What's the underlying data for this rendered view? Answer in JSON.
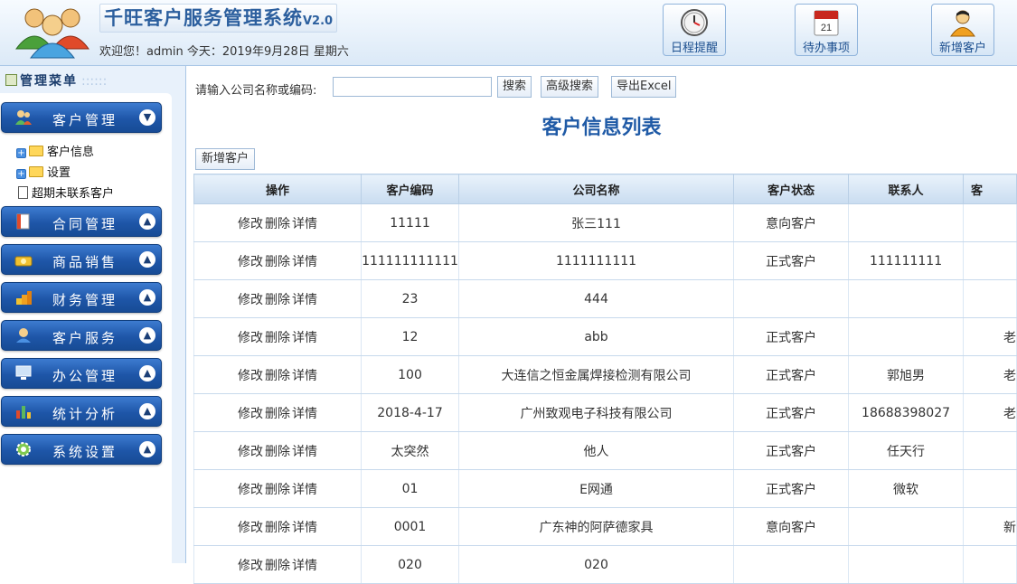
{
  "header": {
    "title": "千旺客户服务管理系统",
    "version": "V2.0",
    "welcome": "欢迎您！admin 今天：2019年9月28日  星期六",
    "buttons": [
      {
        "label": "日程提醒",
        "icon": "clock-icon"
      },
      {
        "label": "待办事项",
        "icon": "calendar-icon"
      },
      {
        "label": "新增客户",
        "icon": "user-add-icon"
      }
    ],
    "calendar_day": "21"
  },
  "sidebar": {
    "title": "管理菜单",
    "menus": [
      {
        "label": "客户管理",
        "icon": "users-icon",
        "toggle": "▼"
      },
      {
        "label": "合同管理",
        "icon": "contract-icon",
        "toggle": "▲"
      },
      {
        "label": "商品销售",
        "icon": "money-icon",
        "toggle": "▲"
      },
      {
        "label": "财务管理",
        "icon": "coins-icon",
        "toggle": "▲"
      },
      {
        "label": "客户服务",
        "icon": "service-icon",
        "toggle": "▲"
      },
      {
        "label": "办公管理",
        "icon": "computer-icon",
        "toggle": "▲"
      },
      {
        "label": "统计分析",
        "icon": "chart-icon",
        "toggle": "▲"
      },
      {
        "label": "系统设置",
        "icon": "gear-icon",
        "toggle": "▲"
      }
    ],
    "tree": [
      {
        "label": "客户信息"
      },
      {
        "label": "设置"
      },
      {
        "label": "超期未联系客户"
      }
    ]
  },
  "main": {
    "search_label": "请输入公司名称或编码:",
    "search_value": "",
    "search_button": "搜索",
    "advanced_button": "高级搜索",
    "export_button": "导出Excel",
    "list_title": "客户信息列表",
    "add_button": "新增客户",
    "columns": [
      "操作",
      "客户编码",
      "公司名称",
      "客户状态",
      "联系人",
      "客"
    ],
    "ops": {
      "edit": "修改",
      "delete": "删除",
      "detail": "详情"
    },
    "rows": [
      {
        "code": "11111",
        "company": "张三111",
        "status": "意向客户",
        "contact": "",
        "extra": ""
      },
      {
        "code": "111111111111",
        "company": "1111111111",
        "status": "正式客户",
        "contact": "111111111",
        "extra": ""
      },
      {
        "code": "23",
        "company": "444",
        "status": "",
        "contact": "",
        "extra": ""
      },
      {
        "code": "12",
        "company": "abb",
        "status": "正式客户",
        "contact": "",
        "extra": "老"
      },
      {
        "code": "100",
        "company": "大连信之恒金属焊接检测有限公司",
        "status": "正式客户",
        "contact": "郭旭男",
        "extra": "老"
      },
      {
        "code": "2018-4-17",
        "company": "广州致观电子科技有限公司",
        "status": "正式客户",
        "contact": "18688398027",
        "extra": "老"
      },
      {
        "code": "太突然",
        "company": "他人",
        "status": "正式客户",
        "contact": "任天行",
        "extra": ""
      },
      {
        "code": "01",
        "company": "E网通",
        "status": "正式客户",
        "contact": "微软",
        "extra": ""
      },
      {
        "code": "0001",
        "company": "广东神的阿萨德家具",
        "status": "意向客户",
        "contact": "",
        "extra": "新"
      },
      {
        "code": "020",
        "company": "020",
        "status": "",
        "contact": "",
        "extra": ""
      }
    ]
  }
}
